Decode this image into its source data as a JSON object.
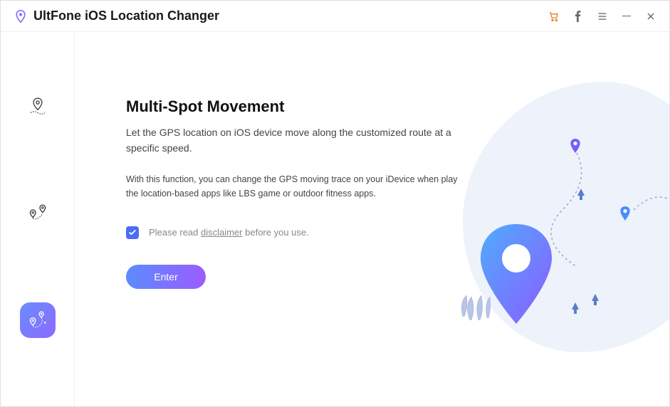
{
  "titlebar": {
    "app_title": "UltFone iOS Location Changer"
  },
  "sidebar": {
    "items": [
      {
        "id": "single-spot",
        "active": false
      },
      {
        "id": "two-spot",
        "active": false
      },
      {
        "id": "multi-spot",
        "active": true
      }
    ]
  },
  "main": {
    "heading": "Multi-Spot Movement",
    "lead": "Let the GPS location on iOS device move along the customized route at a specific speed.",
    "subtext": "With this function, you can change the GPS moving trace on your iDevice when play the location-based apps like LBS game or outdoor fitness apps.",
    "disclaimer_pre": "Please read ",
    "disclaimer_link": "disclaimer",
    "disclaimer_post": " before you use.",
    "disclaimer_checked": true,
    "enter_button": "Enter"
  },
  "colors": {
    "accent_blue": "#4a6cf7",
    "gradient_start": "#5b8cff",
    "gradient_end": "#9c5bff",
    "cart_orange": "#e67e22"
  }
}
